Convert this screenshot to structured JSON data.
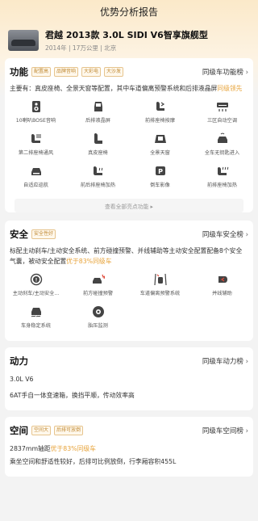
{
  "page_title": "优势分析报告",
  "car": {
    "title": "君越 2013款 3.0L SIDI V6智享旗舰型",
    "meta": "2014年 | 17万公里 | 北京"
  },
  "function": {
    "title": "功能",
    "tags": [
      "配置高",
      "品牌音响",
      "大彩电",
      "大沙发"
    ],
    "rank": "同级车功能榜",
    "desc_prefix": "主要有：真皮座椅、全景天窗等配置，其中车道偏离预警系统和后排液晶屏",
    "desc_highlight": "同级领先",
    "features": [
      {
        "label": "10喇叭BOSE音响",
        "icon": "speaker-icon"
      },
      {
        "label": "后排液晶屏",
        "icon": "rear-screen-icon"
      },
      {
        "label": "前排座椅按摩",
        "icon": "seat-massage-icon"
      },
      {
        "label": "三区自动空调",
        "icon": "air-conditioner-icon"
      },
      {
        "label": "第二排座椅通风",
        "icon": "seat-ventilation-icon"
      },
      {
        "label": "真皮座椅",
        "icon": "leather-seat-icon"
      },
      {
        "label": "全景天窗",
        "icon": "sunroof-icon"
      },
      {
        "label": "全车无钥匙进入",
        "icon": "keyless-entry-icon"
      },
      {
        "label": "自适应巡航",
        "icon": "cruise-control-icon"
      },
      {
        "label": "前后排座椅加热",
        "icon": "seat-heating-icon"
      },
      {
        "label": "倒车影像",
        "icon": "parking-camera-icon"
      },
      {
        "label": "前排座椅加热",
        "icon": "front-seat-heating-icon"
      }
    ],
    "more_label": "查看全部亮点功能 ▸"
  },
  "safety": {
    "title": "安全",
    "tags": [
      "安全性好"
    ],
    "rank": "同级车安全榜",
    "desc_prefix": "标配主动刹车/主动安全系统、前方碰撞预警、并线辅助等主动安全配置配备8个安全气囊，被动安全配置",
    "desc_highlight": "优于83%同级车",
    "features": [
      {
        "label": "主动刹车/主动安全...",
        "icon": "active-brake-icon"
      },
      {
        "label": "前方碰撞预警",
        "icon": "collision-warning-icon"
      },
      {
        "label": "车道偏离预警系统",
        "icon": "lane-departure-icon"
      },
      {
        "label": "并线辅助",
        "icon": "blind-spot-icon"
      },
      {
        "label": "车身稳定系统",
        "icon": "stability-control-icon"
      },
      {
        "label": "胎压监测",
        "icon": "tire-pressure-icon"
      }
    ]
  },
  "power": {
    "title": "动力",
    "rank": "同级车动力榜",
    "line1": "3.0L V6",
    "line2": "6AT手自一体变速箱，换挡平顺，传动效率高"
  },
  "space": {
    "title": "空间",
    "tags": [
      "空间大",
      "后排可放倒"
    ],
    "rank": "同级车空间榜",
    "line1_prefix": "2837mm轴距",
    "line1_highlight": "优于83%同级车",
    "line2": "乘坐空间和舒适性较好，后排可比例放倒，行李厢容积455L"
  }
}
